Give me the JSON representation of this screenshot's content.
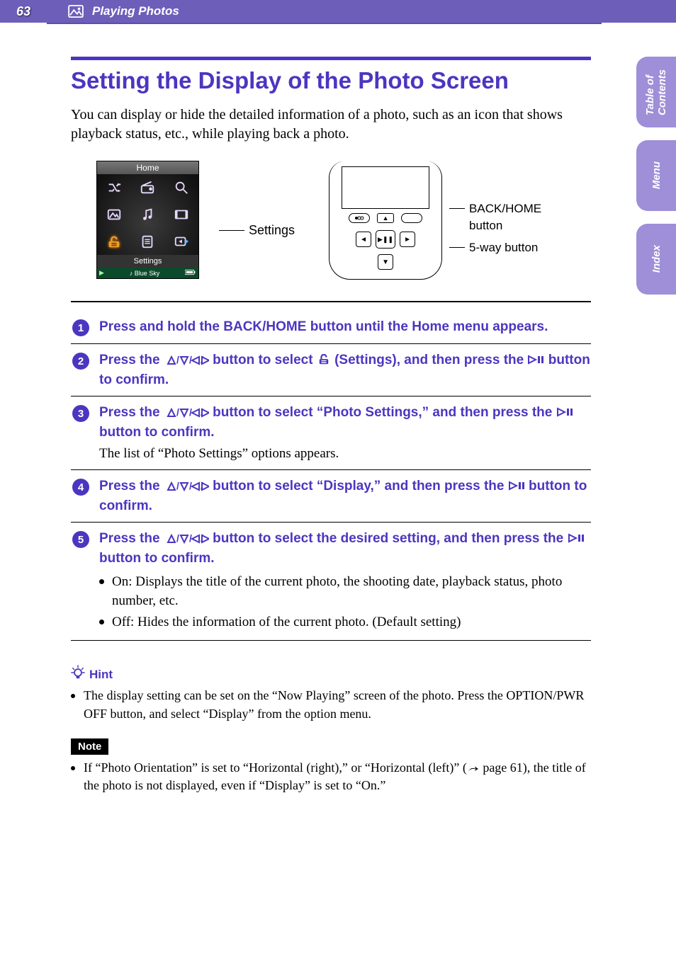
{
  "header": {
    "page_number": "63",
    "breadcrumb": "Playing Photos"
  },
  "sidetabs": {
    "toc_top": "Table of",
    "toc_bot": "Contents",
    "menu": "Menu",
    "index": "Index"
  },
  "title": "Setting the Display of the Photo Screen",
  "intro": "You can display or hide the detailed information of a photo, such as an icon that shows playback status, etc., while playing back a photo.",
  "home_screen": {
    "title": "Home",
    "caption": "Settings",
    "now_playing_icon": "▶",
    "now_playing_label": "Blue Sky",
    "pointer_label": "Settings"
  },
  "device": {
    "callout_back_home_l1": "BACK/HOME",
    "callout_back_home_l2": "button",
    "callout_5way": "5-way button",
    "center_label": "▶❚❚"
  },
  "steps": [
    {
      "n": "1",
      "title_parts": [
        "Press and hold the BACK/HOME button until the Home menu appears."
      ]
    },
    {
      "n": "2",
      "title_pre": "Press the ",
      "title_mid1": " button to select ",
      "title_mid2": " (Settings), and then press the ",
      "title_post": " button to confirm."
    },
    {
      "n": "3",
      "title_pre": "Press the ",
      "title_mid": " button to select “Photo Settings,” and then press the ",
      "title_post": " button to confirm.",
      "text": "The list of “Photo Settings” options appears."
    },
    {
      "n": "4",
      "title_pre": "Press the ",
      "title_mid": " button to select “Display,” and then press the ",
      "title_post": " button to confirm."
    },
    {
      "n": "5",
      "title_pre": "Press the ",
      "title_mid": " button to select the desired setting, and then press the ",
      "title_post": " button to confirm.",
      "opts": [
        "On: Displays the title of the current photo, the shooting date, playback status, photo number, etc.",
        "Off: Hides the information of the current photo. (Default setting)"
      ]
    }
  ],
  "hint": {
    "label": "Hint",
    "items": [
      "The display setting can be set on the “Now Playing” screen of the photo. Press the OPTION/PWR OFF button, and select “Display” from the option menu."
    ]
  },
  "note": {
    "label": "Note",
    "item_pre": "If “Photo Orientation” is set to “Horizontal (right),” or “Horizontal (left)” (",
    "page_ref": " page 61",
    "item_post": "), the title of the photo is not displayed, even if “Display” is set to “On.”"
  }
}
